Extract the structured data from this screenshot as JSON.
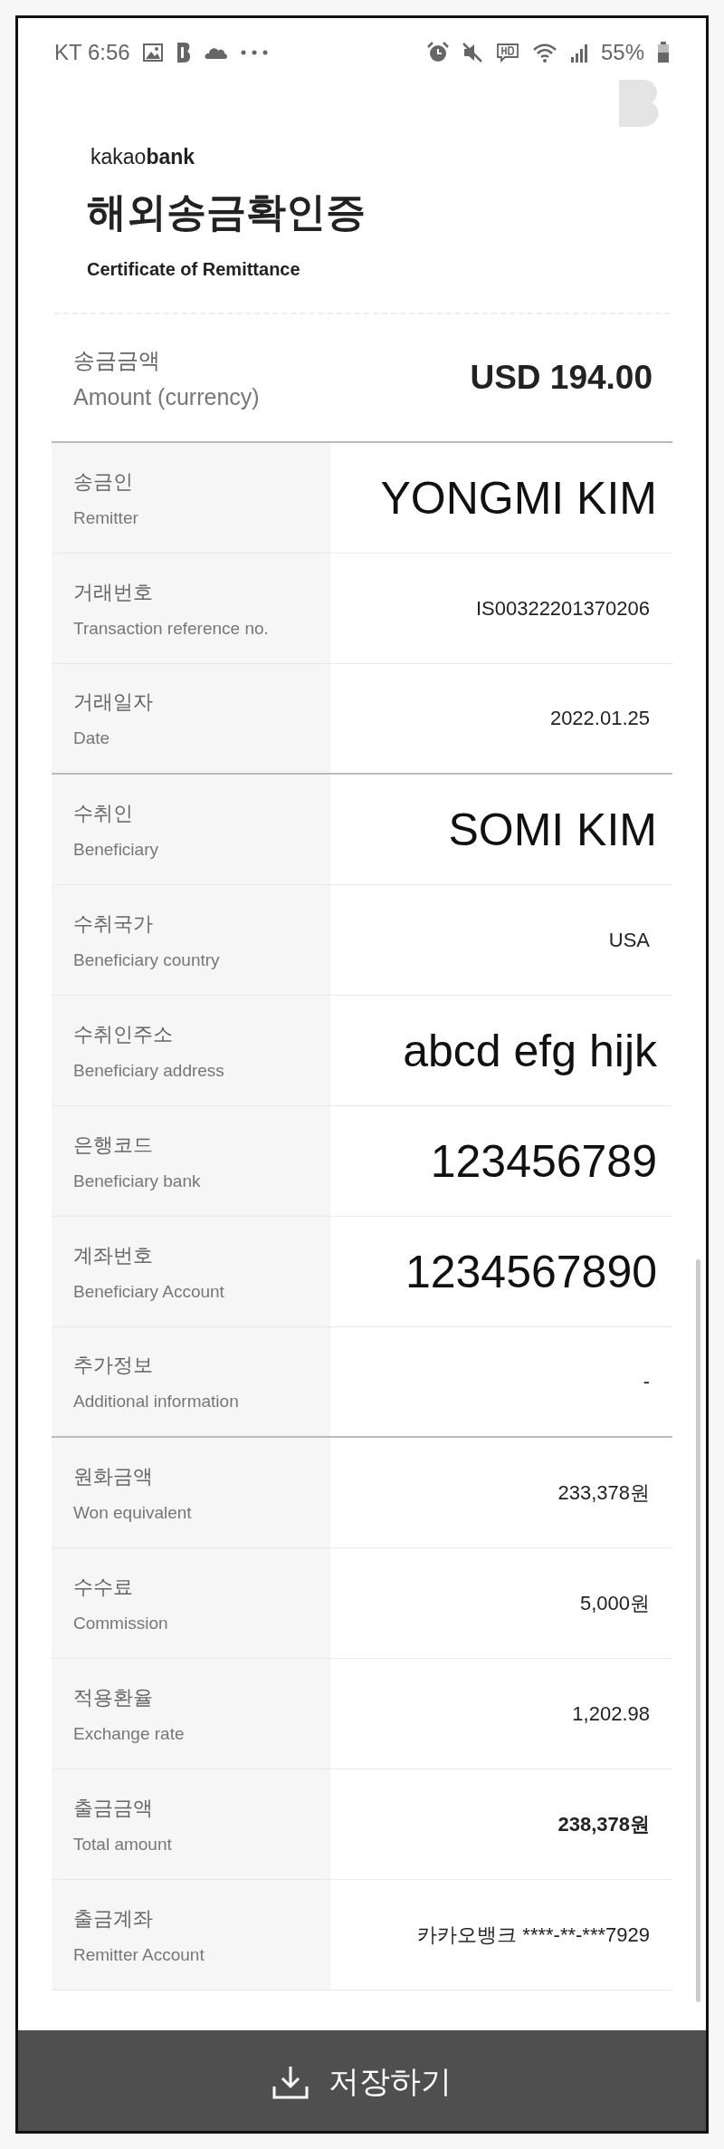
{
  "status_bar": {
    "carrier_time": "KT 6:56",
    "battery": "55%"
  },
  "header": {
    "brand": "kakao**bank**",
    "title": "해외송금확인증",
    "subtitle": "Certificate of Remittance"
  },
  "amount": {
    "label_ko": "송금금액",
    "label_en": "Amount (currency)",
    "value": "USD 194.00"
  },
  "rows": [
    {
      "label_ko": "송금인",
      "label_en": "Remitter",
      "value": "YONGMI KIM",
      "kind": "large",
      "group_end": false
    },
    {
      "label_ko": "거래번호",
      "label_en": "Transaction reference no.",
      "value": "IS00322201370206",
      "kind": "normal",
      "group_end": false
    },
    {
      "label_ko": "거래일자",
      "label_en": "Date",
      "value": "2022.01.25",
      "kind": "normal",
      "group_end": true
    },
    {
      "label_ko": "수취인",
      "label_en": "Beneficiary",
      "value": "SOMI KIM",
      "kind": "large",
      "group_end": false
    },
    {
      "label_ko": "수취국가",
      "label_en": "Beneficiary country",
      "value": "USA",
      "kind": "normal",
      "group_end": false
    },
    {
      "label_ko": "수취인주소",
      "label_en": "Beneficiary address",
      "value": "abcd efg hijk",
      "kind": "large",
      "group_end": false
    },
    {
      "label_ko": "은행코드",
      "label_en": "Beneficiary bank",
      "value": "123456789",
      "kind": "large",
      "group_end": false
    },
    {
      "label_ko": "계좌번호",
      "label_en": "Beneficiary Account",
      "value": "1234567890",
      "kind": "large",
      "group_end": false
    },
    {
      "label_ko": "추가정보",
      "label_en": "Additional information",
      "value": "-",
      "kind": "normal",
      "group_end": true
    },
    {
      "label_ko": "원화금액",
      "label_en": "Won equivalent",
      "value": "233,378원",
      "kind": "normal",
      "group_end": false
    },
    {
      "label_ko": "수수료",
      "label_en": "Commission",
      "value": "5,000원",
      "kind": "normal",
      "group_end": false
    },
    {
      "label_ko": "적용환율",
      "label_en": "Exchange rate",
      "value": "1,202.98",
      "kind": "normal",
      "group_end": false
    },
    {
      "label_ko": "출금금액",
      "label_en": "Total amount",
      "value": "238,378원",
      "kind": "bold",
      "group_end": false
    },
    {
      "label_ko": "출금계좌",
      "label_en": "Remitter Account",
      "value": "카카오뱅크 ****-**-***7929",
      "kind": "normal",
      "group_end": false
    }
  ],
  "save_button": {
    "label": "저장하기"
  }
}
